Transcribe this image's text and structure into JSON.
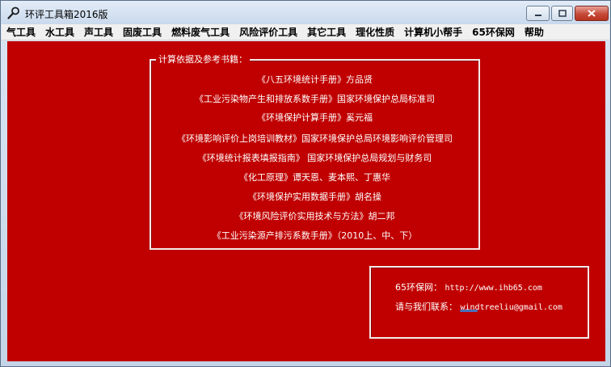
{
  "window": {
    "title": "环评工具箱2016版",
    "icon": "wrench-magnifier-icon"
  },
  "menu": [
    "气工具",
    "水工具",
    "声工具",
    "固废工具",
    "燃料废气工具",
    "风险评价工具",
    "其它工具",
    "理化性质",
    "计算机小帮手",
    "65环保网",
    "帮助"
  ],
  "references": {
    "legend": "计算依据及参考书籍：",
    "lines": [
      "《八五环境统计手册》方品贤",
      "《工业污染物产生和排放系数手册》国家环境保护总局标准司",
      "《环境保护计算手册》奚元福",
      "《环境影响评价上岗培训教材》国家环境保护总局环境影响评价管理司",
      "《环境统计报表填报指南》    国家环境保护总局规划与财务司",
      "《化工原理》谭天恩、麦本熙、丁惠华",
      "《环境保护实用数据手册》胡名操",
      "《环境风险评价实用技术与方法》胡二邦",
      "《工业污染源产排污系数手册》（2010上、中、下）"
    ]
  },
  "contact": {
    "site_label": "65环保网：",
    "site_url": "http://www.ihb65.com",
    "email_label": "请与我们联系：",
    "email": "windtreeliu@gmail.com"
  },
  "colors": {
    "client_bg": "#c00000",
    "text": "#ffffff"
  }
}
